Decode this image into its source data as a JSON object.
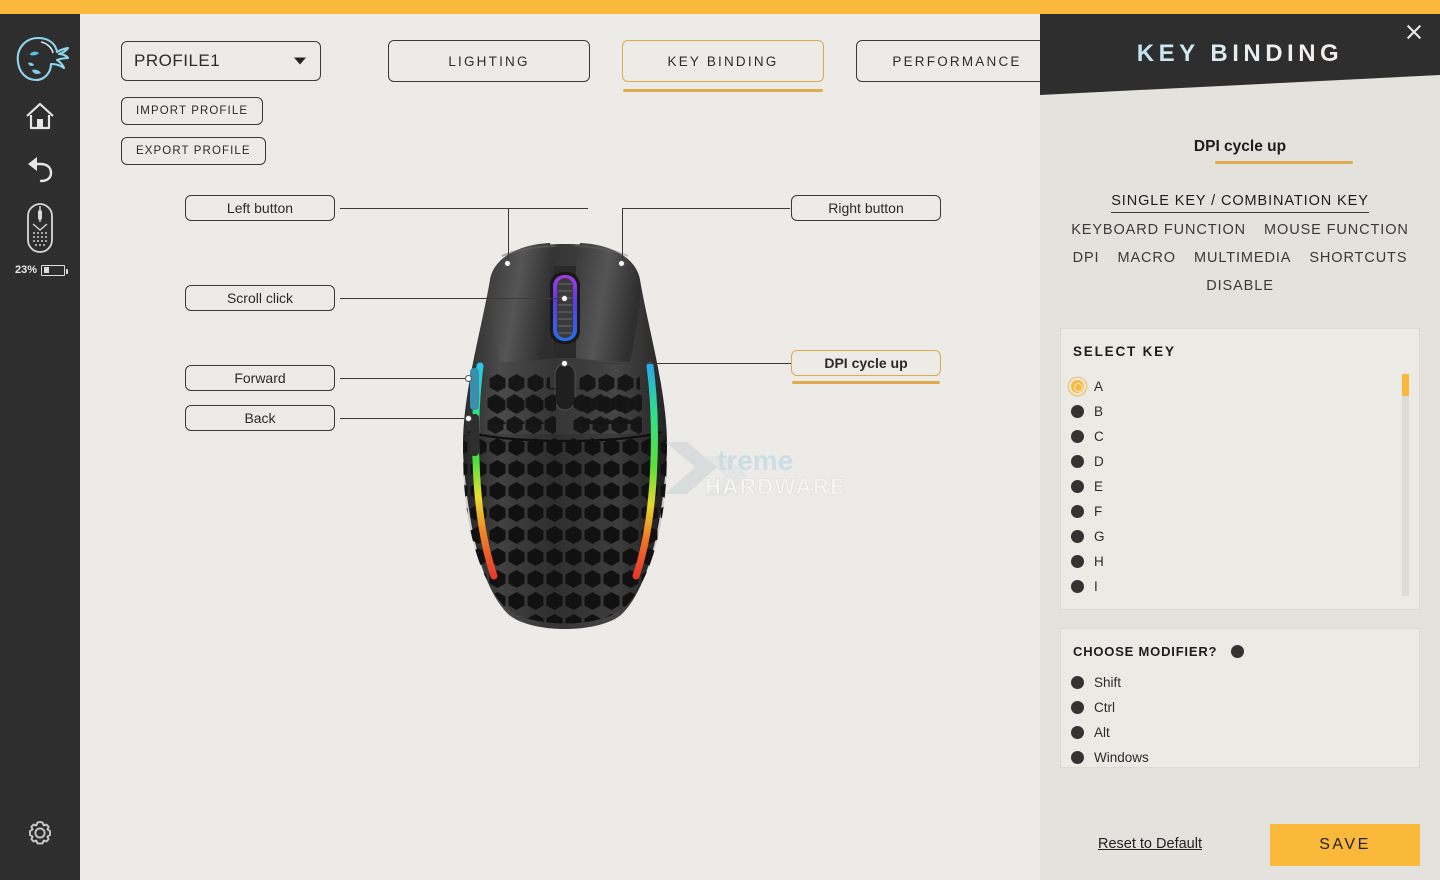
{
  "theme": {
    "accent": "#fbb93c",
    "accent_line": "#e0ab4c",
    "dark": "#2e2e2e",
    "stage_bg": "#ecebe7",
    "panel_bg": "#e3e2dc"
  },
  "sidebar": {
    "logo_name": "glorious-logo",
    "items": [
      {
        "name": "home-icon",
        "label": "Home"
      },
      {
        "name": "undo-icon",
        "label": "Back"
      },
      {
        "name": "mouse-device-icon",
        "label": "Device"
      }
    ],
    "battery": {
      "percent": "23%",
      "icon": "battery-icon"
    },
    "settings": {
      "name": "gear-icon",
      "label": "Settings"
    }
  },
  "toolbar": {
    "profile_value": "PROFILE1",
    "import_label": "IMPORT PROFILE",
    "export_label": "EXPORT PROFILE"
  },
  "tabs": [
    {
      "label": "LIGHTING",
      "active": false
    },
    {
      "label": "KEY BINDING",
      "active": true
    },
    {
      "label": "PERFORMANCE",
      "active": false
    }
  ],
  "callouts": [
    {
      "label": "Left button",
      "highlight": false
    },
    {
      "label": "Scroll click",
      "highlight": false
    },
    {
      "label": "Forward",
      "highlight": false
    },
    {
      "label": "Back",
      "highlight": false
    },
    {
      "label": "Right button",
      "highlight": false
    },
    {
      "label": "DPI cycle up",
      "highlight": true
    }
  ],
  "watermark": {
    "line1": "Xtreme",
    "line2": "HARDWARE"
  },
  "panel": {
    "title": "KEY BINDING",
    "close_label": "Close",
    "subtitle": "DPI cycle up",
    "categories": [
      {
        "label": "SINGLE KEY / COMBINATION KEY",
        "active": true
      },
      {
        "label": "KEYBOARD FUNCTION",
        "active": false
      },
      {
        "label": "MOUSE FUNCTION",
        "active": false
      },
      {
        "label": "DPI",
        "active": false
      },
      {
        "label": "MACRO",
        "active": false
      },
      {
        "label": "MULTIMEDIA",
        "active": false
      },
      {
        "label": "SHORTCUTS",
        "active": false
      },
      {
        "label": "DISABLE",
        "active": false
      }
    ],
    "select_key": {
      "title": "SELECT KEY",
      "selected": "A",
      "options": [
        "A",
        "B",
        "C",
        "D",
        "E",
        "F",
        "G",
        "H",
        "I"
      ]
    },
    "modifier": {
      "title": "CHOOSE MODIFIER?",
      "options": [
        "Shift",
        "Ctrl",
        "Alt",
        "Windows"
      ],
      "selected": []
    },
    "reset_label": "Reset to Default",
    "save_label": "SAVE"
  }
}
